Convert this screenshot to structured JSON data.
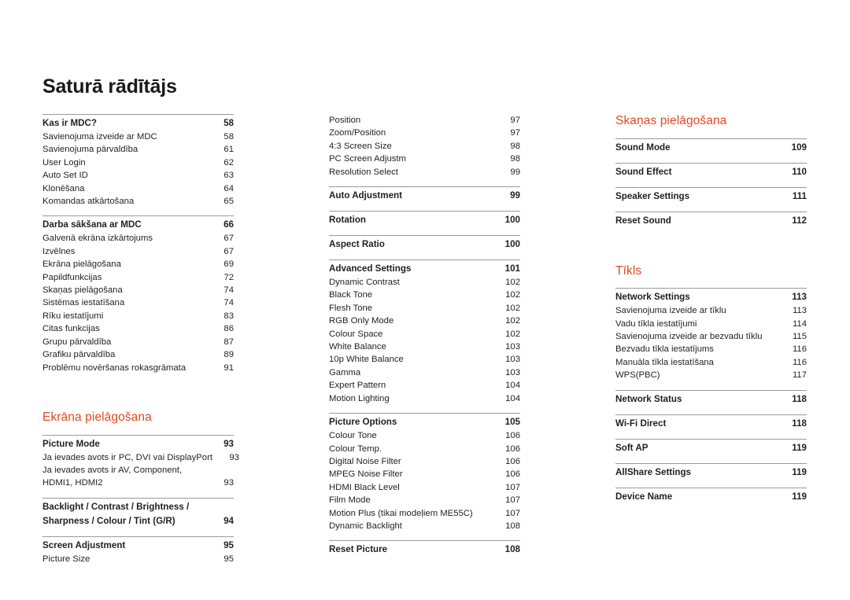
{
  "document": {
    "title": "Saturā rādītājs",
    "accent_color": "#e04a21",
    "text_color": "#231f20",
    "rule_color": "#9a9a9a"
  },
  "columns": [
    {
      "id": "column-1",
      "blocks": [
        {
          "type": "toc-block",
          "rows": [
            {
              "label": "Kas ir MDC?",
              "page": "58",
              "bold": true
            },
            {
              "label": "Savienojuma izveide ar MDC",
              "page": "58",
              "bold": false
            },
            {
              "label": "Savienojuma pārvaldība",
              "page": "61",
              "bold": false
            },
            {
              "label": "User Login",
              "page": "62",
              "bold": false
            },
            {
              "label": "Auto Set ID",
              "page": "63",
              "bold": false
            },
            {
              "label": "Klonēšana",
              "page": "64",
              "bold": false
            },
            {
              "label": "Komandas atkārtošana",
              "page": "65",
              "bold": false
            }
          ]
        },
        {
          "type": "toc-block",
          "rows": [
            {
              "label": "Darba sākšana ar MDC",
              "page": "66",
              "bold": true
            },
            {
              "label": "Galvenā ekrāna izkārtojums",
              "page": "67",
              "bold": false
            },
            {
              "label": "Izvēlnes",
              "page": "67",
              "bold": false
            },
            {
              "label": "Ekrāna pielāgošana",
              "page": "69",
              "bold": false
            },
            {
              "label": "Papildfunkcijas",
              "page": "72",
              "bold": false
            },
            {
              "label": "Skaņas pielāgošana",
              "page": "74",
              "bold": false
            },
            {
              "label": "Sistēmas iestatīšana",
              "page": "74",
              "bold": false
            },
            {
              "label": "Rīku iestatījumi",
              "page": "83",
              "bold": false
            },
            {
              "label": "Citas funkcijas",
              "page": "86",
              "bold": false
            },
            {
              "label": "Grupu pārvaldība",
              "page": "87",
              "bold": false
            },
            {
              "label": "Grafiku pārvaldība",
              "page": "89",
              "bold": false
            },
            {
              "label": "Problēmu novēršanas rokasgrāmata",
              "page": "91",
              "bold": false
            }
          ]
        }
      ],
      "section": {
        "heading": "Ekrāna pielāgošana",
        "blocks": [
          {
            "type": "toc-block",
            "rows": [
              {
                "label": "Picture Mode",
                "page": "93",
                "bold": true
              },
              {
                "label": "Ja ievades avots ir PC, DVI vai DisplayPort",
                "page": "93",
                "bold": false
              },
              {
                "label": "Ja ievades avots ir AV, Component, HDMI1, HDMI2",
                "page": "93",
                "bold": false,
                "wrap": true
              }
            ]
          },
          {
            "type": "toc-block",
            "rows": [
              {
                "label": "Backlight / Contrast / Brightness / Sharpness / Colour / Tint (G/R)",
                "page": "94",
                "bold": true,
                "wrap": true
              }
            ]
          },
          {
            "type": "toc-block",
            "rows": [
              {
                "label": "Screen Adjustment",
                "page": "95",
                "bold": true
              },
              {
                "label": "Picture Size",
                "page": "95",
                "bold": false
              }
            ]
          }
        ]
      }
    },
    {
      "id": "column-2",
      "blocks": [
        {
          "type": "toc-block",
          "no_rule": true,
          "rows": [
            {
              "label": "Position",
              "page": "97",
              "bold": false
            },
            {
              "label": "Zoom/Position",
              "page": "97",
              "bold": false
            },
            {
              "label": "4:3 Screen Size",
              "page": "98",
              "bold": false
            },
            {
              "label": "PC Screen Adjustm",
              "page": "98",
              "bold": false
            },
            {
              "label": "Resolution Select",
              "page": "99",
              "bold": false
            }
          ]
        },
        {
          "type": "toc-block",
          "rows": [
            {
              "label": "Auto Adjustment",
              "page": "99",
              "bold": true
            }
          ]
        },
        {
          "type": "toc-block",
          "rows": [
            {
              "label": "Rotation",
              "page": "100",
              "bold": true
            }
          ]
        },
        {
          "type": "toc-block",
          "rows": [
            {
              "label": "Aspect Ratio",
              "page": "100",
              "bold": true
            }
          ]
        },
        {
          "type": "toc-block",
          "rows": [
            {
              "label": "Advanced Settings",
              "page": "101",
              "bold": true
            },
            {
              "label": "Dynamic Contrast",
              "page": "102",
              "bold": false
            },
            {
              "label": "Black Tone",
              "page": "102",
              "bold": false
            },
            {
              "label": "Flesh Tone",
              "page": "102",
              "bold": false
            },
            {
              "label": "RGB Only Mode",
              "page": "102",
              "bold": false
            },
            {
              "label": "Colour Space",
              "page": "102",
              "bold": false
            },
            {
              "label": "White Balance",
              "page": "103",
              "bold": false
            },
            {
              "label": "10p White Balance",
              "page": "103",
              "bold": false
            },
            {
              "label": "Gamma",
              "page": "103",
              "bold": false
            },
            {
              "label": "Expert Pattern",
              "page": "104",
              "bold": false
            },
            {
              "label": "Motion Lighting",
              "page": "104",
              "bold": false
            }
          ]
        },
        {
          "type": "toc-block",
          "rows": [
            {
              "label": "Picture Options",
              "page": "105",
              "bold": true
            },
            {
              "label": "Colour Tone",
              "page": "106",
              "bold": false
            },
            {
              "label": "Colour Temp.",
              "page": "106",
              "bold": false
            },
            {
              "label": "Digital Noise Filter",
              "page": "106",
              "bold": false
            },
            {
              "label": "MPEG Noise Filter",
              "page": "106",
              "bold": false
            },
            {
              "label": "HDMI Black Level",
              "page": "107",
              "bold": false
            },
            {
              "label": "Film Mode",
              "page": "107",
              "bold": false
            },
            {
              "label": "Motion Plus  (tikai modeļiem ME55C)",
              "page": "107",
              "bold": false
            },
            {
              "label": "Dynamic Backlight",
              "page": "108",
              "bold": false
            }
          ]
        },
        {
          "type": "toc-block",
          "rows": [
            {
              "label": "Reset Picture",
              "page": "108",
              "bold": true
            }
          ]
        }
      ]
    },
    {
      "id": "column-3",
      "sections": [
        {
          "heading": "Skaņas pielāgošana",
          "blocks": [
            {
              "type": "toc-block",
              "rows": [
                {
                  "label": "Sound Mode",
                  "page": "109",
                  "bold": true
                }
              ]
            },
            {
              "type": "toc-block",
              "rows": [
                {
                  "label": "Sound Effect",
                  "page": "110",
                  "bold": true
                }
              ]
            },
            {
              "type": "toc-block",
              "rows": [
                {
                  "label": "Speaker Settings",
                  "page": "111",
                  "bold": true
                }
              ]
            },
            {
              "type": "toc-block",
              "rows": [
                {
                  "label": "Reset Sound",
                  "page": "112",
                  "bold": true
                }
              ]
            }
          ]
        },
        {
          "heading": "Tīkls",
          "blocks": [
            {
              "type": "toc-block",
              "rows": [
                {
                  "label": "Network Settings",
                  "page": "113",
                  "bold": true
                },
                {
                  "label": "Savienojuma izveide ar tīklu",
                  "page": "113",
                  "bold": false
                },
                {
                  "label": "Vadu tīkla iestatījumi",
                  "page": "114",
                  "bold": false
                },
                {
                  "label": "Savienojuma izveide ar bezvadu tīklu",
                  "page": "115",
                  "bold": false
                },
                {
                  "label": "Bezvadu tīkla iestatījums",
                  "page": "116",
                  "bold": false
                },
                {
                  "label": "Manuāla tīkla iestatīšana",
                  "page": "116",
                  "bold": false
                },
                {
                  "label": "WPS(PBC)",
                  "page": "117",
                  "bold": false
                }
              ]
            },
            {
              "type": "toc-block",
              "rows": [
                {
                  "label": "Network Status",
                  "page": "118",
                  "bold": true
                }
              ]
            },
            {
              "type": "toc-block",
              "rows": [
                {
                  "label": "Wi-Fi Direct",
                  "page": "118",
                  "bold": true
                }
              ]
            },
            {
              "type": "toc-block",
              "rows": [
                {
                  "label": "Soft AP",
                  "page": "119",
                  "bold": true
                }
              ]
            },
            {
              "type": "toc-block",
              "rows": [
                {
                  "label": "AllShare Settings",
                  "page": "119",
                  "bold": true
                }
              ]
            },
            {
              "type": "toc-block",
              "rows": [
                {
                  "label": "Device Name",
                  "page": "119",
                  "bold": true
                }
              ]
            }
          ]
        }
      ]
    }
  ]
}
